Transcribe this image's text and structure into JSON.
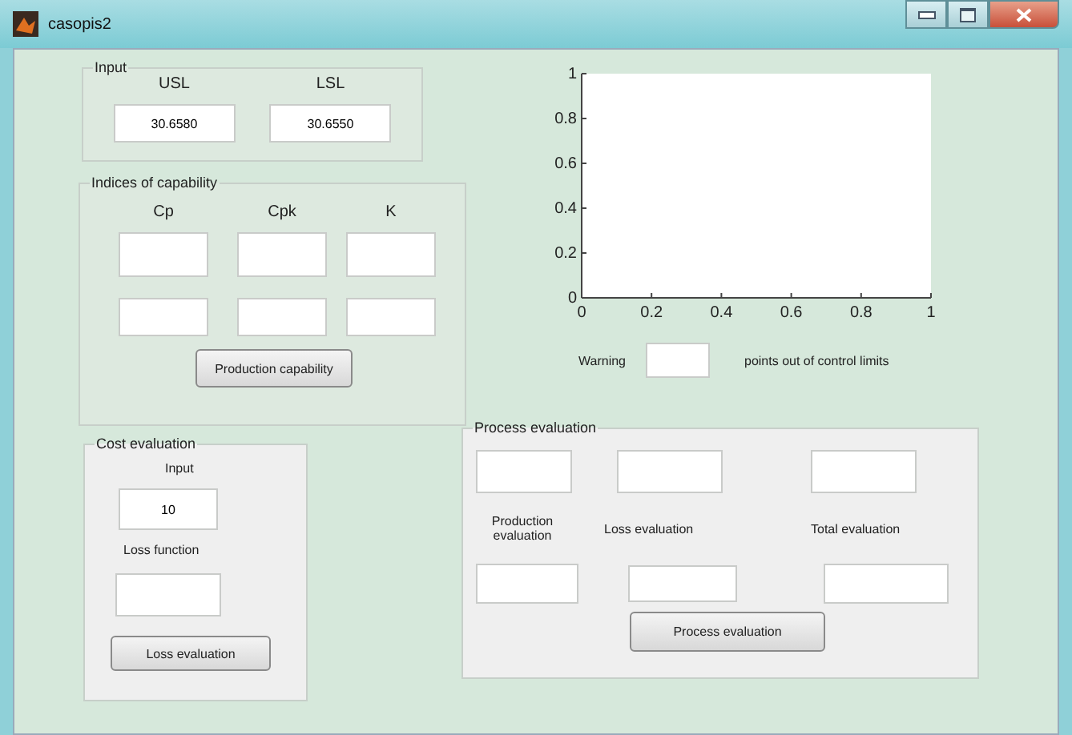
{
  "window": {
    "title": "casopis2"
  },
  "input_panel": {
    "title": "Input",
    "fields": [
      {
        "label": "USL",
        "value": "30.6580"
      },
      {
        "label": "LSL",
        "value": "30.6550"
      }
    ]
  },
  "indices_panel": {
    "title": "Indices of capability",
    "columns": [
      "Cp",
      "Cpk",
      "K"
    ],
    "button": "Production capability"
  },
  "axes": {
    "chart_data": {
      "type": "line",
      "xlim": [
        0,
        1
      ],
      "ylim": [
        0,
        1
      ],
      "xticks": [
        {
          "value": 0,
          "label": "0"
        },
        {
          "value": 0.2,
          "label": "0.2"
        },
        {
          "value": 0.4,
          "label": "0.4"
        },
        {
          "value": 0.6,
          "label": "0.6"
        },
        {
          "value": 0.8,
          "label": "0.8"
        },
        {
          "value": 1,
          "label": "1"
        }
      ],
      "yticks": [
        {
          "value": 0,
          "label": "0"
        },
        {
          "value": 0.2,
          "label": "0.2"
        },
        {
          "value": 0.4,
          "label": "0.4"
        },
        {
          "value": 0.6,
          "label": "0.6"
        },
        {
          "value": 0.8,
          "label": "0.8"
        },
        {
          "value": 1,
          "label": "1"
        }
      ]
    }
  },
  "warning": {
    "label": "Warning",
    "suffix": "points out  of control limits"
  },
  "cost_panel": {
    "title": "Cost evaluation",
    "input_label": "Input",
    "input_value": "10",
    "loss_label": "Loss function",
    "button": "Loss evaluation"
  },
  "process_panel": {
    "title": "Process evaluation",
    "labels": [
      "Production evaluation",
      "Loss evaluation",
      "Total evaluation"
    ],
    "button": "Process evaluation"
  }
}
